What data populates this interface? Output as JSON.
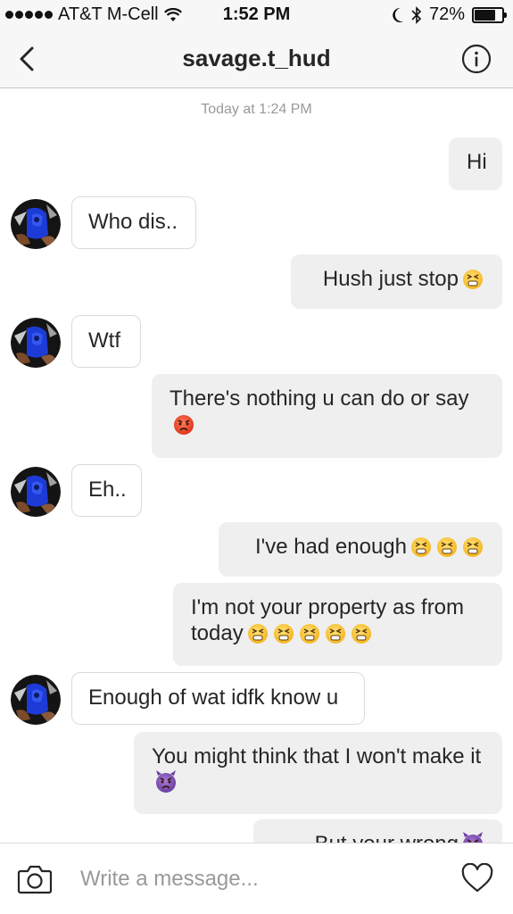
{
  "status_bar": {
    "carrier": "AT&T M-Cell",
    "time": "1:52 PM",
    "battery": "72%",
    "battery_level": 0.72,
    "signal_bars": 5
  },
  "header": {
    "title": "savage.t_hud",
    "back_icon": "chevron-left-icon",
    "info_icon": "info-circle-icon"
  },
  "chat": {
    "timestamp": "Today at 1:24 PM",
    "messages": [
      {
        "side": "out",
        "text": "Hi",
        "emoji": []
      },
      {
        "side": "in",
        "text": "Who dis..",
        "emoji": []
      },
      {
        "side": "out",
        "text": "Hush just stop",
        "emoji": [
          "persevering-face"
        ]
      },
      {
        "side": "in",
        "text": "Wtf",
        "emoji": []
      },
      {
        "side": "out",
        "text": "There's nothing u can do or say",
        "emoji": [
          "angry-face"
        ]
      },
      {
        "side": "in",
        "text": "Eh..",
        "emoji": []
      },
      {
        "side": "out",
        "text": "I've had enough",
        "emoji": [
          "persevering-face",
          "persevering-face",
          "persevering-face"
        ]
      },
      {
        "side": "out",
        "text": "I'm not your property as from today",
        "emoji": [
          "persevering-face",
          "persevering-face",
          "persevering-face",
          "persevering-face",
          "persevering-face"
        ]
      },
      {
        "side": "in",
        "text": "Enough of wat idfk know u",
        "emoji": []
      },
      {
        "side": "out",
        "text": "You might think that I won't make it",
        "emoji": [
          "purple-devil-face"
        ]
      },
      {
        "side": "out",
        "text": "But your wrong",
        "emoji": [
          "purple-devil-face"
        ]
      }
    ]
  },
  "composer": {
    "placeholder": "Write a message...",
    "camera_icon": "camera-icon",
    "heart_icon": "heart-icon"
  },
  "colors": {
    "bar_background": "#f7f7f7",
    "outgoing_bubble": "#efefef",
    "incoming_border": "#dbdbdb",
    "placeholder": "#999999",
    "text": "#262626"
  }
}
